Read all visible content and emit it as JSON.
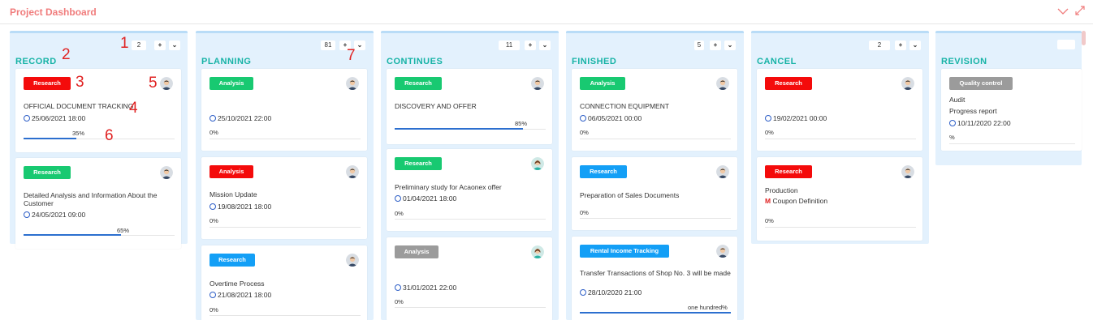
{
  "header": {
    "title": "Project Dashboard",
    "icons": [
      "chevron-down-icon",
      "expand-icon"
    ],
    "accent": "#f07c7c"
  },
  "annotations": {
    "a1": "1",
    "a2": "2",
    "a3": "3",
    "a4": "4",
    "a5": "5",
    "a6": "6",
    "a7": "7"
  },
  "columns": [
    {
      "title": "RECORD",
      "count": "2",
      "add": "+",
      "more": "⌄",
      "cards": [
        {
          "tag": "Research",
          "tag_color": "red",
          "title": "OFFICIAL DOCUMENT TRACKING",
          "date": "25/06/2021 18:00",
          "progress": "35%",
          "progress_value": 35
        },
        {
          "tag": "Research",
          "tag_color": "green",
          "title": "Detailed Analysis and Information About the Customer",
          "date": "24/05/2021 09:00",
          "progress": "65%",
          "progress_value": 65
        }
      ]
    },
    {
      "title": "PLANNING",
      "count": "81",
      "add": "+",
      "more": "⌄",
      "cards": [
        {
          "tag": "Analysis",
          "tag_color": "green",
          "title": "",
          "date": "25/10/2021 22:00",
          "progress": "0%",
          "progress_value": 0
        },
        {
          "tag": "Analysis",
          "tag_color": "red",
          "title": "Mission Update",
          "date": "19/08/2021 18:00",
          "progress": "0%",
          "progress_value": 0
        },
        {
          "tag": "Research",
          "tag_color": "blue",
          "title": "Overtime Process",
          "date": "21/08/2021 18:00",
          "progress": "0%",
          "progress_value": 0
        }
      ]
    },
    {
      "title": "CONTINUES",
      "count": "11",
      "add": "+",
      "more": "⌄",
      "cards": [
        {
          "tag": "Research",
          "tag_color": "green",
          "title": "DISCOVERY AND OFFER",
          "date": "",
          "progress": "85%",
          "progress_value": 85
        },
        {
          "tag": "Research",
          "tag_color": "green",
          "title": "Preliminary study for Acaonex offer",
          "date": "01/04/2021 18:00",
          "progress": "0%",
          "progress_value": 0
        },
        {
          "tag": "Analysis",
          "tag_color": "gray",
          "title": "",
          "date": "31/01/2021 22:00",
          "progress": "0%",
          "progress_value": 0
        }
      ]
    },
    {
      "title": "FINISHED",
      "count": "5",
      "add": "+",
      "more": "⌄",
      "cards": [
        {
          "tag": "Analysis",
          "tag_color": "green",
          "title": "CONNECTION EQUIPMENT",
          "date": "06/05/2021 00:00",
          "progress": "0%",
          "progress_value": 0
        },
        {
          "tag": "Research",
          "tag_color": "blue",
          "title": "Preparation of Sales Documents",
          "date": "",
          "progress": "0%",
          "progress_value": 0
        },
        {
          "tag": "Rental Income Tracking",
          "tag_color": "blue",
          "title": "Transfer Transactions of Shop No. 3 will be made",
          "date": "28/10/2020 21:00",
          "progress": "one hundred%",
          "progress_value": 100
        }
      ]
    },
    {
      "title": "CANCEL",
      "count": "2",
      "add": "+",
      "more": "⌄",
      "cards": [
        {
          "tag": "Research",
          "tag_color": "red",
          "title": "",
          "date": "19/02/2021 00:00",
          "progress": "0%",
          "progress_value": 0
        },
        {
          "tag": "Research",
          "tag_color": "red",
          "title": "Production",
          "subtitle_mark": "M",
          "subtitle": "Coupon Definition",
          "date": "",
          "progress": "0%",
          "progress_value": 0
        }
      ]
    },
    {
      "title": "REVISION",
      "count": "",
      "add": "",
      "more": "",
      "cards": [
        {
          "tag": "Quality control",
          "tag_color": "gray",
          "title": "Audit",
          "subtitle": "Progress report",
          "date": "10/11/2020 22:00",
          "progress": "%",
          "progress_value": 0
        }
      ]
    }
  ]
}
